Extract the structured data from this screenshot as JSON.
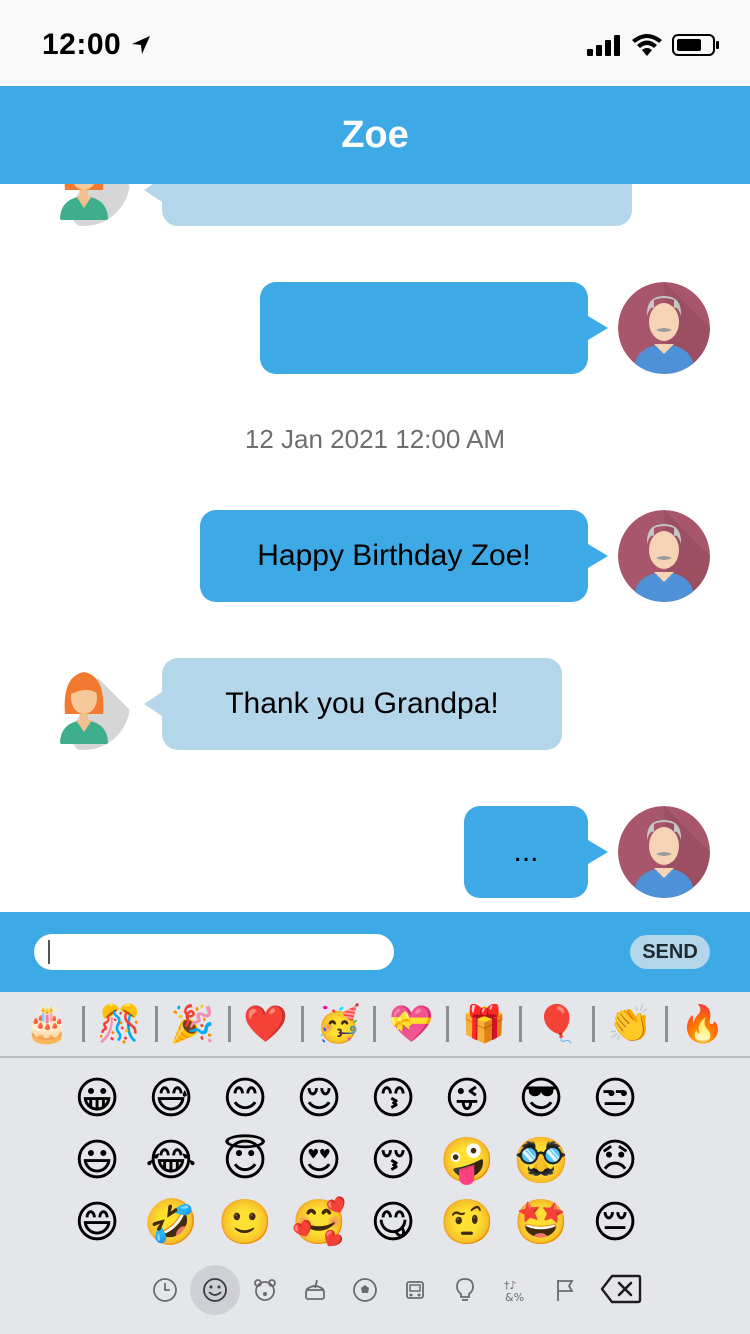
{
  "status_bar": {
    "time": "12:00",
    "icons": [
      "location-arrow-icon",
      "signal-icon",
      "wifi-icon",
      "battery-icon"
    ]
  },
  "header": {
    "title": "Zoe"
  },
  "messages": [
    {
      "sender": "Zoe",
      "side": "left",
      "text": ""
    },
    {
      "sender": "Grandpa",
      "side": "right",
      "text": ""
    },
    {
      "type": "timestamp",
      "text": "12 Jan 2021 12:00 AM"
    },
    {
      "sender": "Grandpa",
      "side": "right",
      "text": "Happy Birthday Zoe!"
    },
    {
      "sender": "Zoe",
      "side": "left",
      "text": "Thank you Grandpa!"
    },
    {
      "sender": "Grandpa",
      "side": "right",
      "text": "..."
    }
  ],
  "composer": {
    "input_value": "",
    "send_label": "SEND"
  },
  "emoji_suggestions": [
    "🎂",
    "🎊",
    "🎉",
    "❤️",
    "🥳",
    "💝",
    "🎁",
    "🎈",
    "👏",
    "🔥"
  ],
  "emoji_grid": [
    "😀",
    "😅",
    "😊",
    "😌",
    "😙",
    "😜",
    "😎",
    "😒",
    "😃",
    "😂",
    "😇",
    "😍",
    "😚",
    "🤪",
    "🥸",
    "😞",
    "😄",
    "🤣",
    "🙂",
    "🥰",
    "😋",
    "🤨",
    "🤩",
    "😔"
  ],
  "keyboard_categories": [
    "recent-icon",
    "smileys-icon",
    "animals-icon",
    "food-icon",
    "activity-icon",
    "travel-icon",
    "objects-icon",
    "symbols-icon",
    "flags-icon"
  ],
  "colors": {
    "accent": "#3daae5",
    "received_bubble": "#b3d6ea",
    "keyboard_bg": "#e5e6ea"
  }
}
